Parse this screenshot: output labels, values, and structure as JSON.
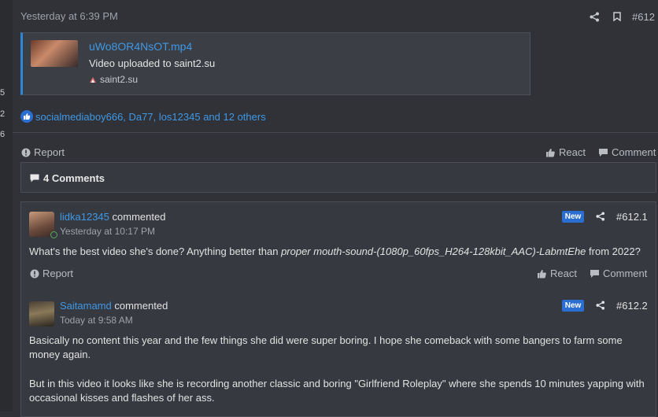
{
  "gutter": {
    "numbers": [
      "5",
      "2",
      "6"
    ]
  },
  "post": {
    "timestamp": "Yesterday at 6:39 PM",
    "post_number": "#612",
    "embed": {
      "filename": "uWo8OR4NsOT.mp4",
      "description": "Video uploaded to saint2.su",
      "domain": "saint2.su"
    },
    "reactions": "socialmediaboy666, Da77, los12345 and 12 others",
    "actions": {
      "report": "Report",
      "react": "React",
      "comment": "Comment"
    }
  },
  "comments_header": {
    "label": "4 Comments"
  },
  "comments": [
    {
      "username": "lidka12345",
      "verb": "commented",
      "time": "Yesterday at 10:17 PM",
      "badge": "New",
      "number": "#612.1",
      "text_prefix": "What's the best video she's done? Anything better than ",
      "text_italic": "proper mouth-sound-(1080p_60fps_H264-128kbit_AAC)-LabmtEhe",
      "text_suffix": " from 2022?",
      "actions": {
        "report": "Report",
        "react": "React",
        "comment": "Comment"
      }
    },
    {
      "username": "Saitamamd",
      "verb": "commented",
      "time": "Today at 9:58 AM",
      "badge": "New",
      "number": "#612.2",
      "paragraph1": "Basically no content this year and the few things she did were super boring. I hope she comeback with some bangers to farm some money again.",
      "paragraph2": "But in this video it looks like she is recording another classic and boring \"Girlfriend Roleplay\" where she spends 10 minutes yapping with occasional kisses and flashes of her ass."
    }
  ],
  "icons": {
    "share": "share-icon",
    "bookmark": "bookmark-icon",
    "report": "report-icon",
    "react": "thumbs-up-icon",
    "comment": "comment-icon",
    "like_badge": "like-badge-icon"
  },
  "colors": {
    "link": "#3e98e6",
    "badge": "#2a6ed1",
    "embed_accent": "#2f86d6"
  }
}
